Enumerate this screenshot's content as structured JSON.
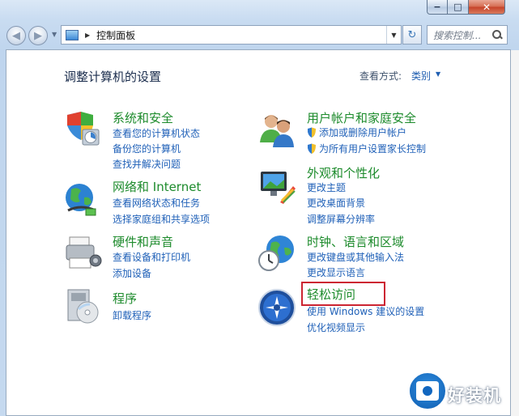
{
  "titlebar": {
    "minimize_glyph": "−",
    "maximize_glyph": "□",
    "close_glyph": "✕"
  },
  "navbar": {
    "back_glyph": "◀",
    "forward_glyph": "▶",
    "address_text": "控制面板",
    "refresh_glyph": "↻",
    "search_placeholder": "搜索控制..."
  },
  "content": {
    "title": "调整计算机的设置",
    "view_by_label": "查看方式:",
    "view_by_value": "类别"
  },
  "categories": [
    {
      "title": "系统和安全",
      "icon": "system-security-icon",
      "links": [
        "查看您的计算机状态",
        "备份您的计算机",
        "查找并解决问题"
      ]
    },
    {
      "title": "网络和 Internet",
      "icon": "network-internet-icon",
      "links": [
        "查看网络状态和任务",
        "选择家庭组和共享选项"
      ]
    },
    {
      "title": "硬件和声音",
      "icon": "hardware-sound-icon",
      "links": [
        "查看设备和打印机",
        "添加设备"
      ]
    },
    {
      "title": "程序",
      "icon": "programs-icon",
      "links": [
        "卸载程序"
      ]
    },
    {
      "title": "用户帐户和家庭安全",
      "icon": "user-accounts-icon",
      "links": [
        "添加或删除用户帐户",
        "为所有用户设置家长控制"
      ]
    },
    {
      "title": "外观和个性化",
      "icon": "appearance-icon",
      "links": [
        "更改主题",
        "更改桌面背景",
        "调整屏幕分辨率"
      ]
    },
    {
      "title": "时钟、语言和区域",
      "icon": "clock-language-icon",
      "links": [
        "更改键盘或其他输入法",
        "更改显示语言"
      ]
    },
    {
      "title": "轻松访问",
      "icon": "ease-of-access-icon",
      "links": [
        "使用 Windows 建议的设置",
        "优化视频显示"
      ]
    }
  ],
  "watermark": {
    "text": "好装机"
  },
  "colors": {
    "category_title": "#1d8b2c",
    "link": "#2061b8",
    "highlight_box": "#cc2432"
  }
}
